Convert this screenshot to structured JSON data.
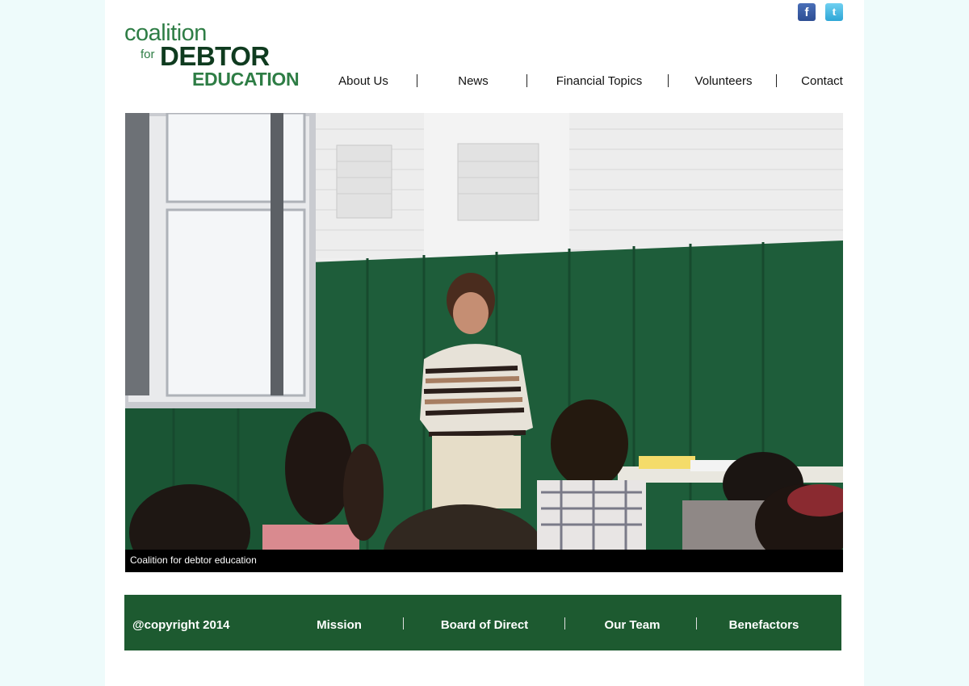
{
  "logo": {
    "line1": "coalition",
    "line2_for": "for",
    "line2_main": "DEBTOR",
    "line3": "EDUCATION"
  },
  "social": {
    "facebook": "f",
    "twitter": "t"
  },
  "nav": {
    "items": [
      {
        "label": "About Us"
      },
      {
        "label": "News"
      },
      {
        "label": "Financial Topics"
      },
      {
        "label": "Volunteers"
      },
      {
        "label": "Contact"
      }
    ]
  },
  "hero": {
    "caption": "Coalition for debtor education"
  },
  "footer": {
    "copyright": "@copyright 2014",
    "links": [
      {
        "label": "Mission"
      },
      {
        "label": "Board of Direct"
      },
      {
        "label": "Our Team"
      },
      {
        "label": "Benefactors"
      }
    ]
  },
  "colors": {
    "brand_green": "#2e7d45",
    "brand_dark": "#0f3b1f",
    "footer_bg": "#1d5a30",
    "page_bg": "#eefbfb"
  }
}
